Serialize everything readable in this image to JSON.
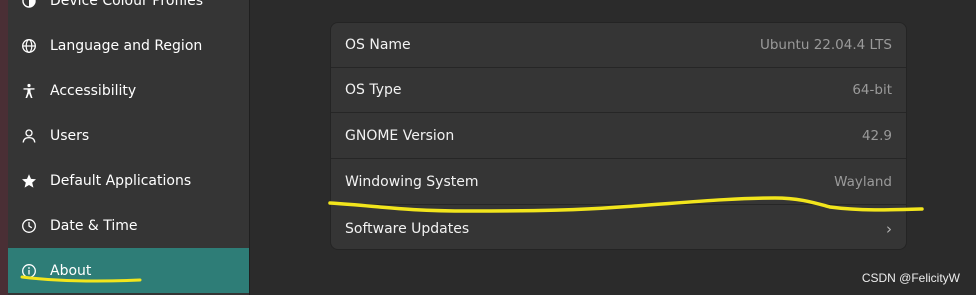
{
  "sidebar": {
    "items": [
      {
        "label": "Device Colour Profiles",
        "icon": "color-profile-icon",
        "active": false
      },
      {
        "label": "Language and Region",
        "icon": "globe-icon",
        "active": false
      },
      {
        "label": "Accessibility",
        "icon": "accessibility-icon",
        "active": false
      },
      {
        "label": "Users",
        "icon": "users-icon",
        "active": false
      },
      {
        "label": "Default Applications",
        "icon": "star-icon",
        "active": false
      },
      {
        "label": "Date & Time",
        "icon": "clock-icon",
        "active": false
      },
      {
        "label": "About",
        "icon": "info-icon",
        "active": true
      }
    ]
  },
  "about": {
    "rows": [
      {
        "label": "OS Name",
        "value": "Ubuntu 22.04.4 LTS"
      },
      {
        "label": "OS Type",
        "value": "64-bit"
      },
      {
        "label": "GNOME Version",
        "value": "42.9"
      },
      {
        "label": "Windowing System",
        "value": "Wayland"
      },
      {
        "label": "Software Updates",
        "value": "",
        "chevron": "›"
      }
    ]
  },
  "annotation_color": "#f2e51c",
  "active_color": "#2e7d77",
  "watermark": "CSDN @FelicityW"
}
